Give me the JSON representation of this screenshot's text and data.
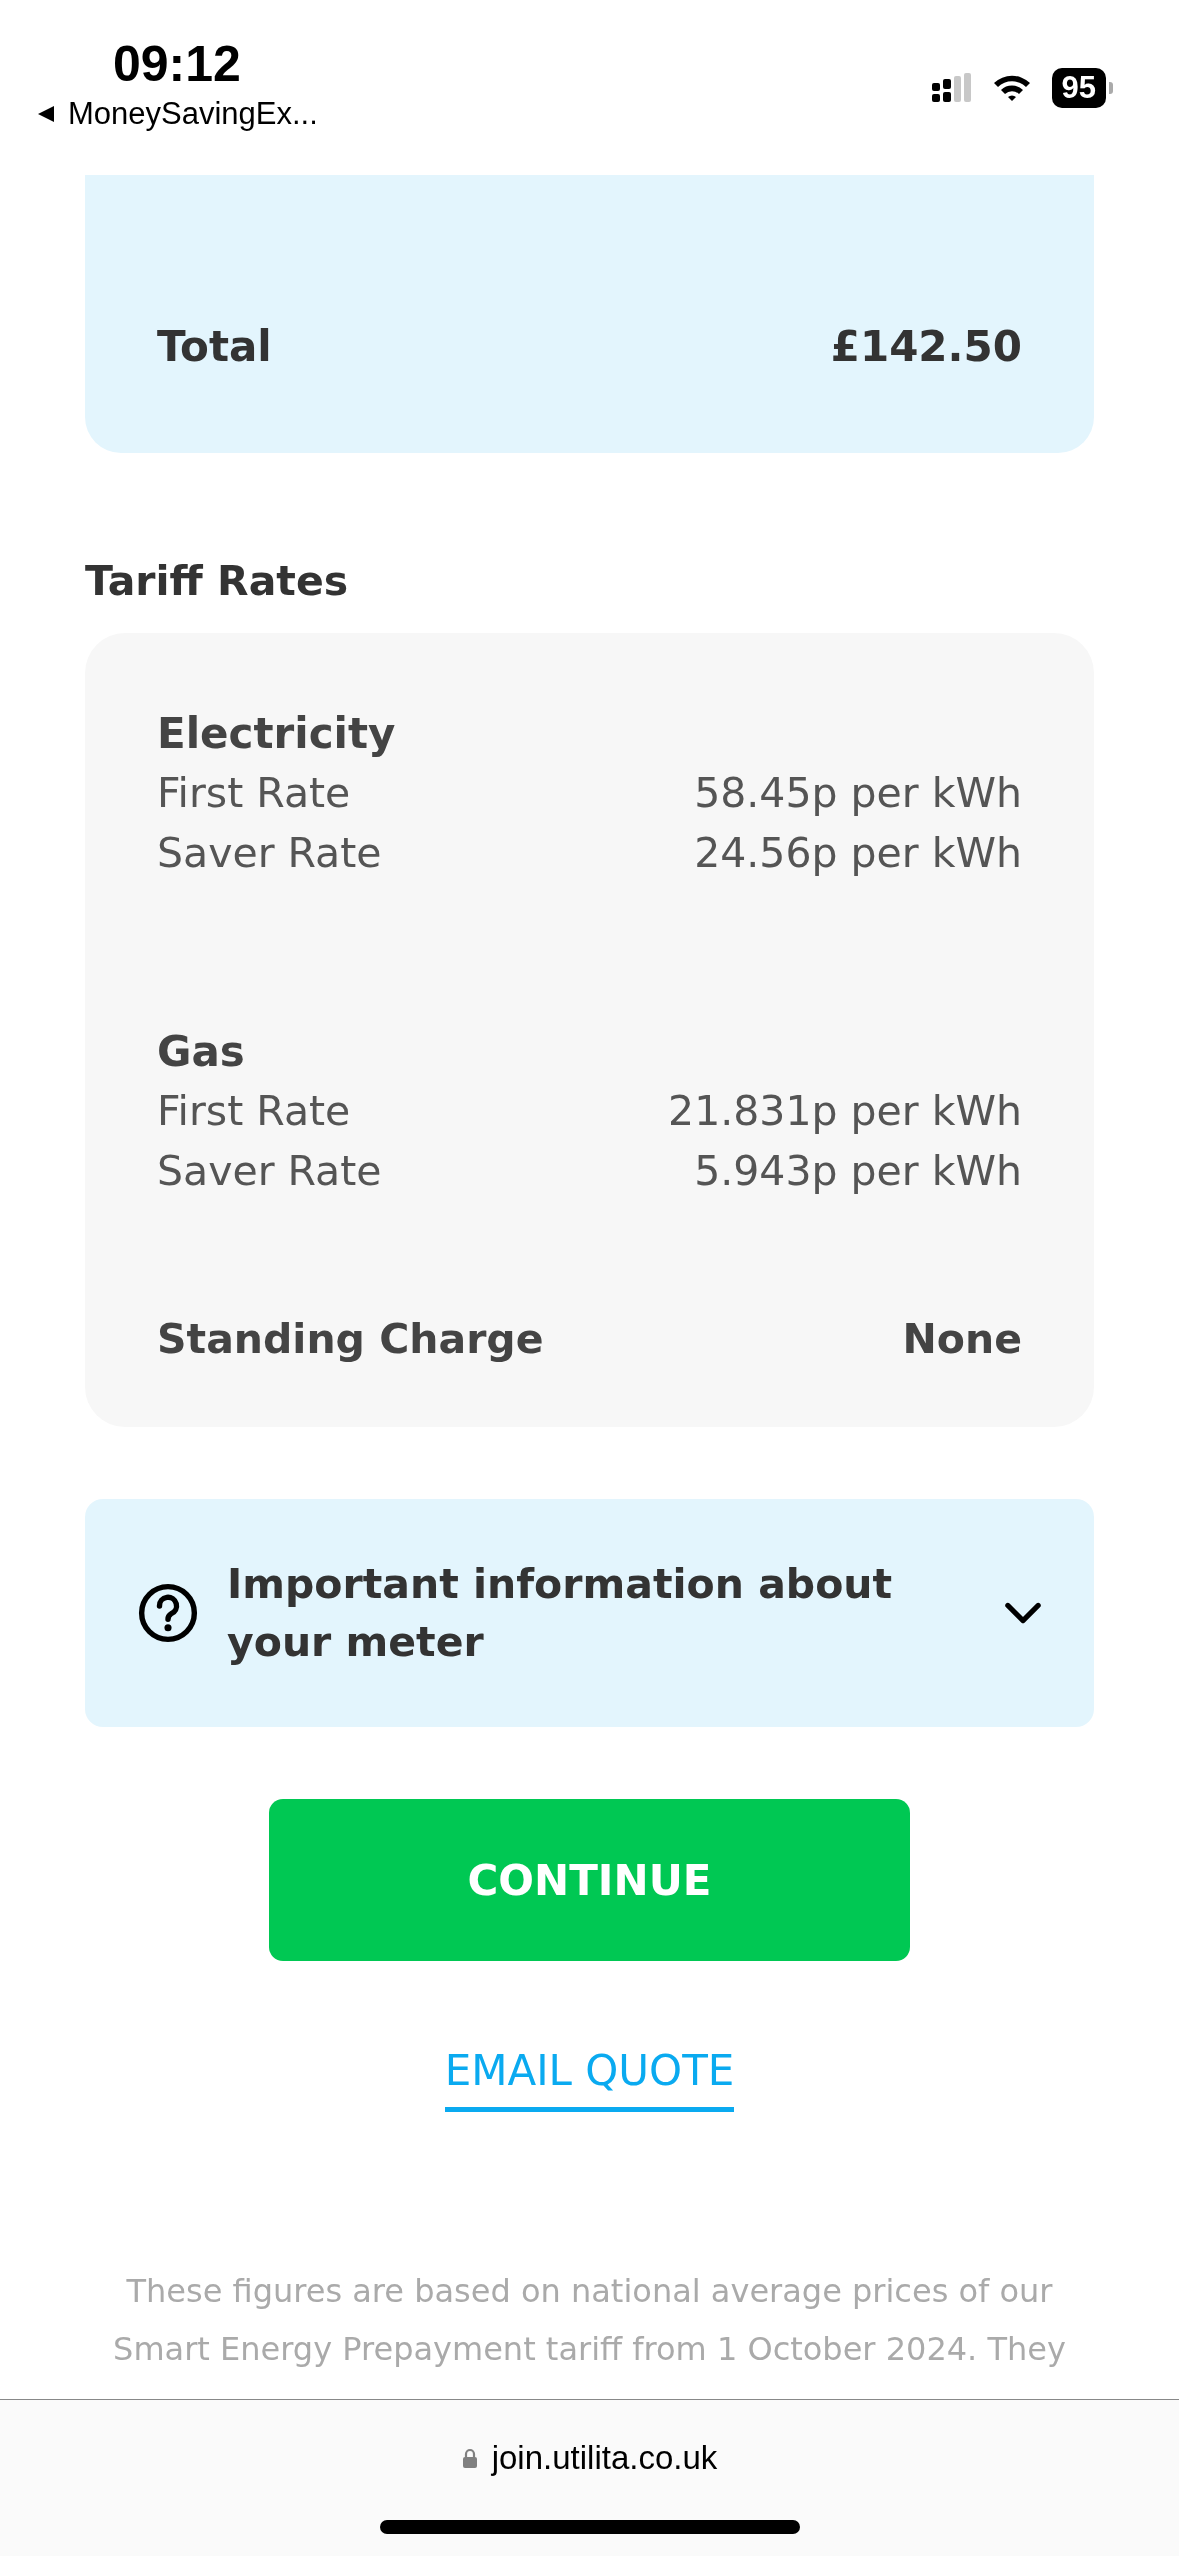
{
  "status_bar": {
    "time": "09:12",
    "back_app": "MoneySavingEx...",
    "battery": "95"
  },
  "total_card": {
    "label": "Total",
    "value": "£142.50"
  },
  "tariff_rates": {
    "title": "Tariff Rates",
    "groups": [
      {
        "name": "Electricity",
        "rates": [
          {
            "label": "First Rate",
            "value": "58.45p per kWh"
          },
          {
            "label": "Saver Rate",
            "value": "24.56p per kWh"
          }
        ]
      },
      {
        "name": "Gas",
        "rates": [
          {
            "label": "First Rate",
            "value": "21.831p per kWh"
          },
          {
            "label": "Saver Rate",
            "value": "5.943p per kWh"
          }
        ]
      }
    ],
    "standing_charge": {
      "label": "Standing Charge",
      "value": "None"
    }
  },
  "info_panel": {
    "title": "Important information about your meter",
    "expanded": false
  },
  "buttons": {
    "continue": "CONTINUE",
    "email_quote": "EMAIL QUOTE"
  },
  "footnote": [
    "These figures are based on national average prices of our",
    "Smart Energy Prepayment tariff from 1 October 2024. They"
  ],
  "browser_bar": {
    "url": "join.utilita.co.uk"
  }
}
